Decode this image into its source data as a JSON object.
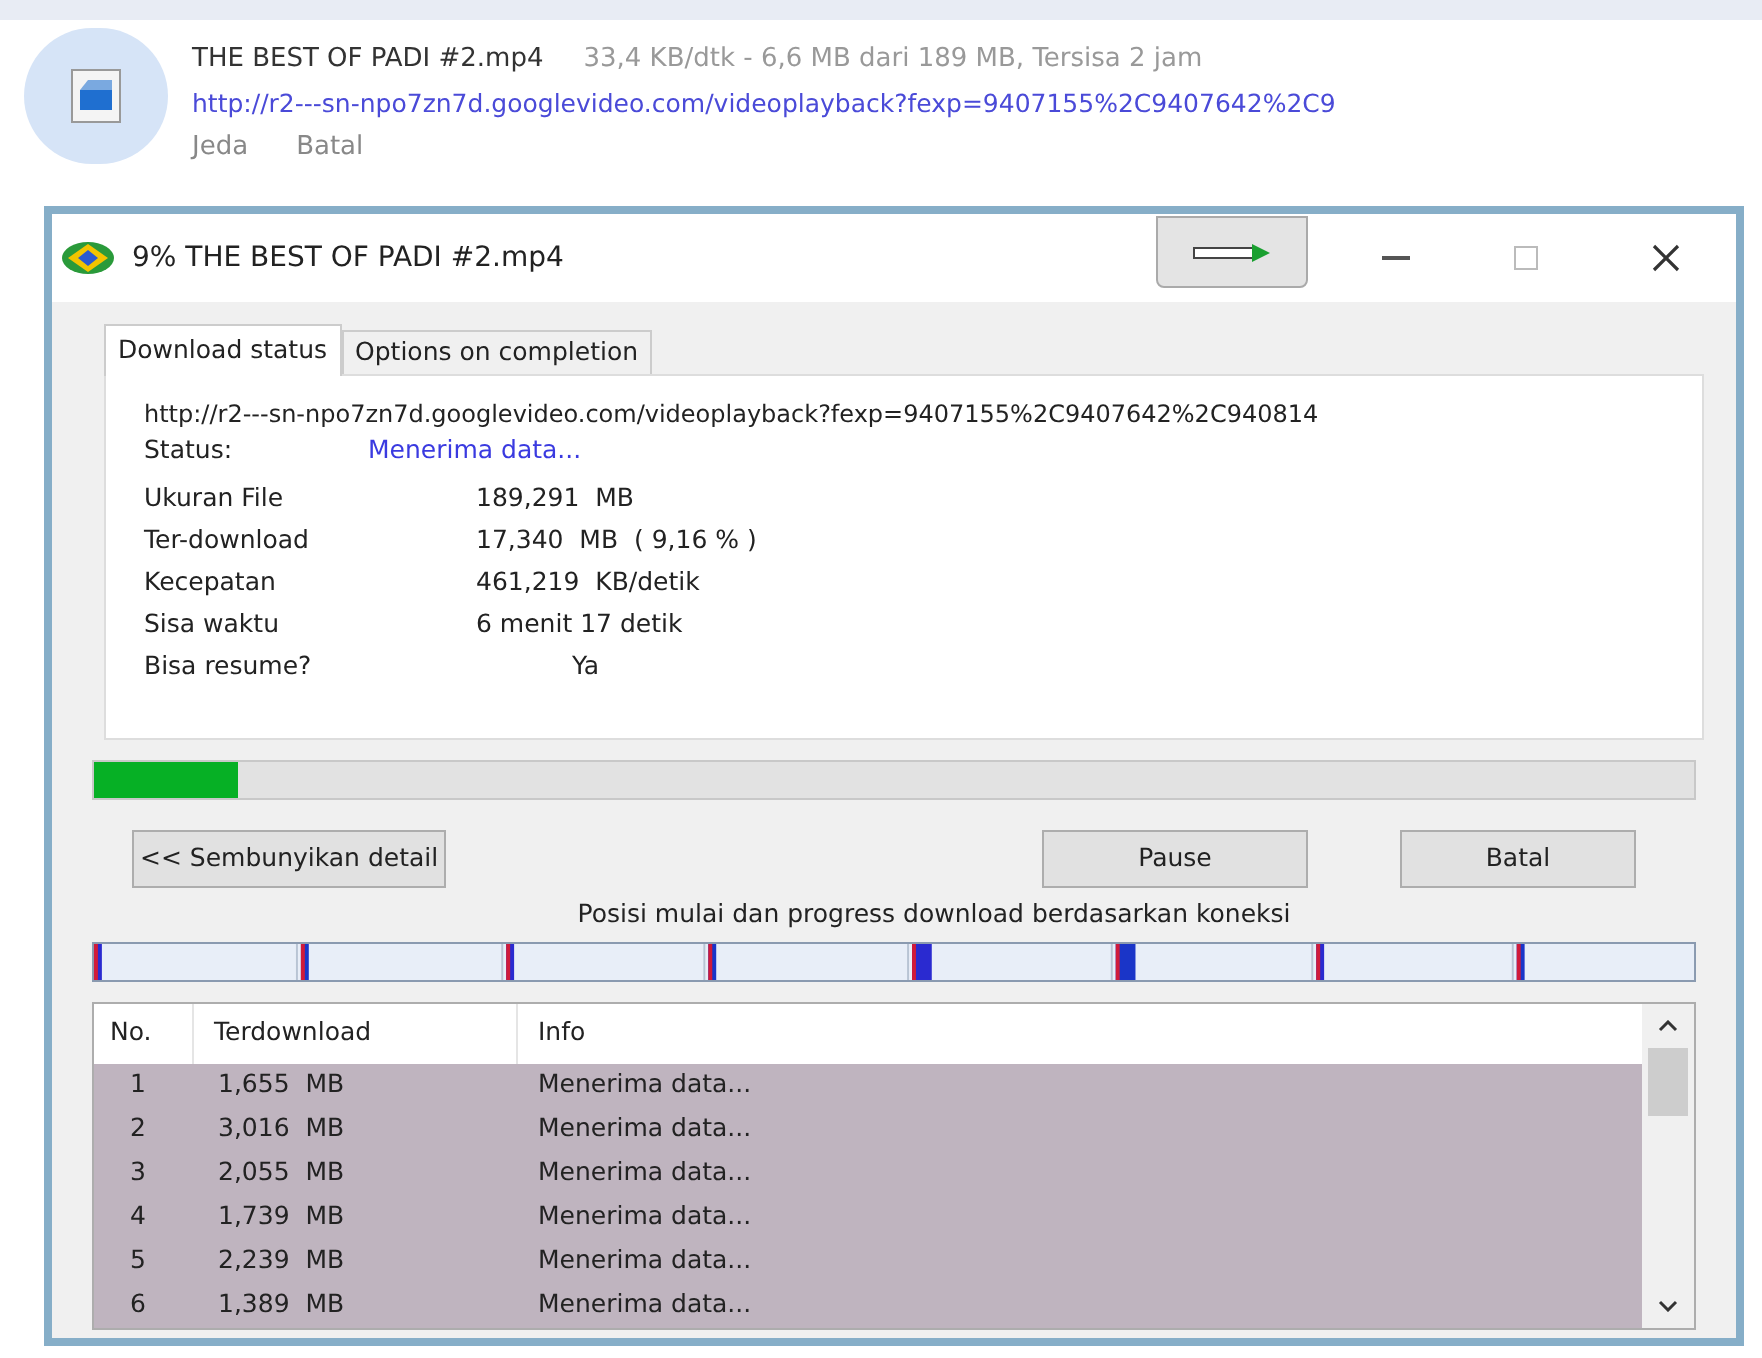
{
  "download_bar": {
    "filename": "THE BEST OF PADI #2.mp4",
    "progress_text": "33,4 KB/dtk - 6,6 MB dari 189 MB, Tersisa 2 jam",
    "url": "http://r2---sn-npo7zn7d.googlevideo.com/videoplayback?fexp=9407155%2C9407642%2C9",
    "actions": [
      "Jeda",
      "Batal"
    ]
  },
  "window": {
    "title": "9% THE BEST OF PADI #2.mp4"
  },
  "tabs": [
    {
      "label": "Download status",
      "selected": true
    },
    {
      "label": "Options on completion",
      "selected": false
    }
  ],
  "details": {
    "url": "http://r2---sn-npo7zn7d.googlevideo.com/videoplayback?fexp=9407155%2C9407642%2C940814",
    "status_label": "Status:",
    "status_value": "Menerima data...",
    "fields": [
      {
        "label": "Ukuran File",
        "value": "189,291  MB",
        "indented": false
      },
      {
        "label": "Ter-download",
        "value": "17,340  MB  ( 9,16 % )",
        "indented": false
      },
      {
        "label": "Kecepatan",
        "value": "461,219  KB/detik",
        "indented": false
      },
      {
        "label": "Sisa waktu",
        "value": "6 menit 17 detik",
        "indented": false
      },
      {
        "label": "Bisa resume?",
        "value": "Ya",
        "indented": true
      }
    ]
  },
  "progress": {
    "level": 0.09
  },
  "buttons": {
    "toggle_details": "<< Sembunyikan detail",
    "pause": "Pause",
    "cancel": "Batal"
  },
  "connections_caption": "Posisi mulai dan progress download berdasarkan koneksi",
  "table": {
    "columns": [
      "No.",
      "Terdownload",
      "Info"
    ],
    "rows": [
      {
        "cells": [
          "1",
          "1,655  MB",
          "Menerima data..."
        ],
        "selected": true
      },
      {
        "cells": [
          "2",
          "3,016  MB",
          "Menerima data..."
        ],
        "selected": true
      },
      {
        "cells": [
          "3",
          "2,055  MB",
          "Menerima data..."
        ],
        "selected": true
      },
      {
        "cells": [
          "4",
          "1,739  MB",
          "Menerima data..."
        ],
        "selected": true
      },
      {
        "cells": [
          "5",
          "2,239  MB",
          "Menerima data..."
        ],
        "selected": true
      },
      {
        "cells": [
          "6",
          "1,389  MB",
          "Menerima data..."
        ],
        "selected": true
      }
    ]
  }
}
